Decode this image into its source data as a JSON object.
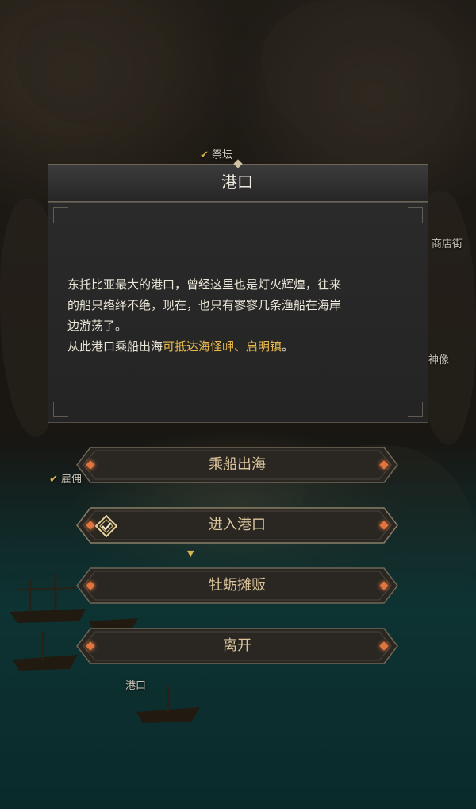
{
  "map_labels": {
    "altar": "祭坛",
    "shop_street": "商店街",
    "statue": "神像",
    "hire": "雇佣",
    "port": "港口"
  },
  "dialog": {
    "title": "港口",
    "desc_line1": "东托比亚最大的港口，曾经这里也是灯火辉煌，往来",
    "desc_line2": "的船只络绎不绝，现在，也只有寥寥几条渔船在海岸",
    "desc_line3": "边游荡了。",
    "route_prefix": "从此港口乘船出海",
    "route_highlight": "可抵达海怪岬、启明镇",
    "route_suffix": "。"
  },
  "buttons": [
    {
      "label": "乘船出海"
    },
    {
      "label": "进入港口"
    },
    {
      "label": "牡蛎摊贩"
    },
    {
      "label": "离开"
    }
  ],
  "colors": {
    "highlight": "#e8b84a",
    "button_text": "#dcc59b",
    "gem": "#e2753f"
  },
  "icons": {
    "checkmark": "check-icon",
    "selected": "selected-diamond-icon",
    "arrow": "chevron-down-icon"
  }
}
